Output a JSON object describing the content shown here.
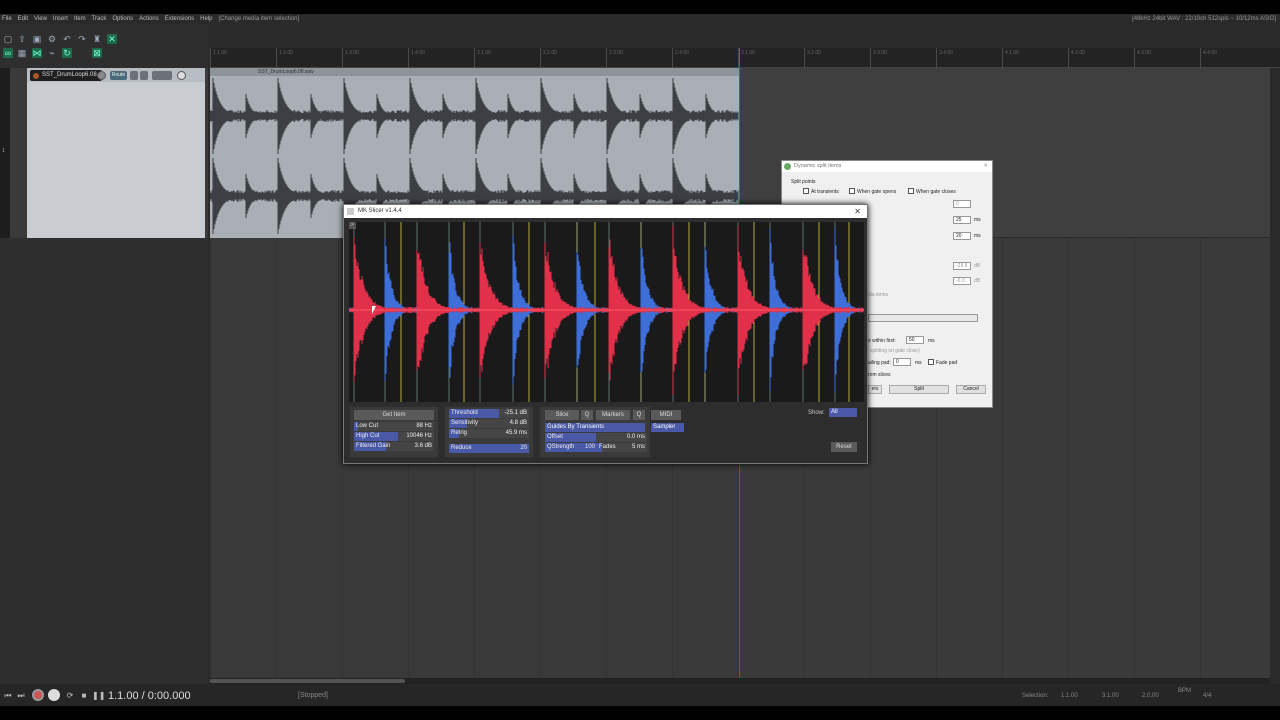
{
  "menu": {
    "items": [
      "File",
      "Edit",
      "View",
      "Insert",
      "Item",
      "Track",
      "Options",
      "Actions",
      "Extensions",
      "Help"
    ],
    "action": "[Change media item selection]",
    "status": "[48kHz 24bit WAV : 22/10ch 512spls ~ 10/12ms ASIO]"
  },
  "track": {
    "name": "SST_DrumLoop6.08",
    "route_label": "Route",
    "number": "1",
    "item_name": "SST_DrumLoop6.08.wav"
  },
  "ruler": {
    "labels": [
      "1.1.00",
      "1.2.00",
      "1.3.00",
      "1.4.00",
      "2.1.00",
      "2.2.00",
      "2.3.00",
      "2.4.00",
      "3.1.00",
      "3.2.00",
      "3.3.00",
      "3.4.00",
      "4.1.00",
      "4.2.00",
      "4.3.00",
      "4.4.00"
    ]
  },
  "transport": {
    "time": "1.1.00 / 0:00.000",
    "status": "[Stopped]",
    "selection_label": "Selection:",
    "sel_start": "1.1.00",
    "sel_end": "3.1.00",
    "sel_len": "2.0.00",
    "bpm_label": "BPM",
    "rate_label": "4/4"
  },
  "dynamic_split": {
    "title": "Dynamic split items",
    "section": "Split points",
    "at_transients": "At transients",
    "gate_opens": "When gate opens",
    "gate_closes": "When gate closes",
    "v1": "0",
    "v2": "25",
    "v2_unit": "ms",
    "v3": "20",
    "v3_unit": "ms",
    "v4": "-29.8",
    "v4_unit": "dB",
    "v5": "-6.0",
    "v5_unit": "dB",
    "items_label": "dia items",
    "within_label": "e within first:",
    "within_value": "50",
    "within_unit": "ms",
    "gate_close_label": "splitting on gate close)",
    "pad_label": "ailing pad:",
    "pad_value": "0",
    "pad_unit": "ms",
    "fade_pad": "Fade pad",
    "slices_label": "rom slices",
    "btn_sets": "ets",
    "btn_split": "Split",
    "btn_cancel": "Cancel"
  },
  "mk_slicer": {
    "title": "MK Slicer v1.4.4",
    "checkbox_glyph": ">",
    "get_item": "Get Item",
    "low_cut": {
      "label": "Low Cut",
      "value": "88 Hz",
      "level": 0.05
    },
    "high_cut": {
      "label": "High Cut",
      "value": "10046 Hz",
      "level": 0.55
    },
    "filtered_gain": {
      "label": "Filtered Gain",
      "value": "3.6 dB",
      "level": 0.4
    },
    "threshold": {
      "label": "Threshold",
      "value": "-25.1 dB",
      "level": 0.62
    },
    "sensitivity": {
      "label": "Sensitivity",
      "value": "4.8 dB",
      "level": 0.22
    },
    "retrig": {
      "label": "Retrig",
      "value": "45.9 ms",
      "level": 0.12
    },
    "reduce": {
      "label": "Reduce",
      "value": "20",
      "level": 1.0
    },
    "slice": "Slice",
    "q1": "Q",
    "markers": "Markers",
    "q2": "Q",
    "midi": "MIDI",
    "guides": "Guides By Transients",
    "sampler": "Sampler",
    "offset": {
      "label": "Offset",
      "value": "0.0 ms",
      "level": 0.5
    },
    "qstrength": {
      "label": "QStrength",
      "value": "100",
      "level": 1.0
    },
    "fades": {
      "label": "Fades",
      "value": "5 ms",
      "level": 0.1
    },
    "show_label": "Show:",
    "show_value": "All",
    "reset": "Reset"
  },
  "icons": [
    "record-icon",
    "play-icon",
    "stop-icon",
    "pause-icon",
    "rewind-icon",
    "forward-icon",
    "loop-icon",
    "close-icon"
  ],
  "colors": {
    "accent": "#4a58a8",
    "wave_red": "#e0304a",
    "wave_blue": "#3e6fd8",
    "guide_yellow": "#b8a93a",
    "record": "#cc5555"
  }
}
